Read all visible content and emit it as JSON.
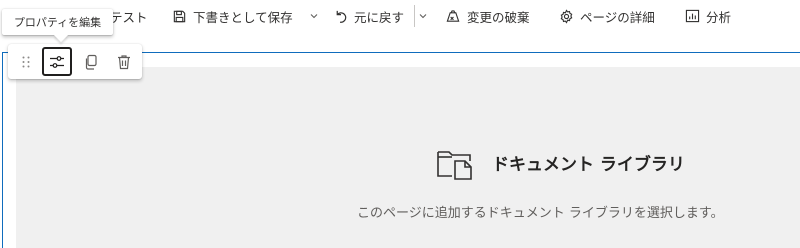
{
  "command_bar": {
    "page_name": "テスト",
    "save_draft": "下書きとして保存",
    "undo": "元に戻す",
    "discard": "変更の破棄",
    "page_details": "ページの詳細",
    "analytics": "分析"
  },
  "tooltip": "プロパティを編集",
  "webpart": {
    "title": "ドキュメント ライブラリ",
    "description": "このページに追加するドキュメント ライブラリを選択します。"
  },
  "colors": {
    "accent": "#0f6cbd",
    "placeholder_bg": "#f0f0f0"
  }
}
